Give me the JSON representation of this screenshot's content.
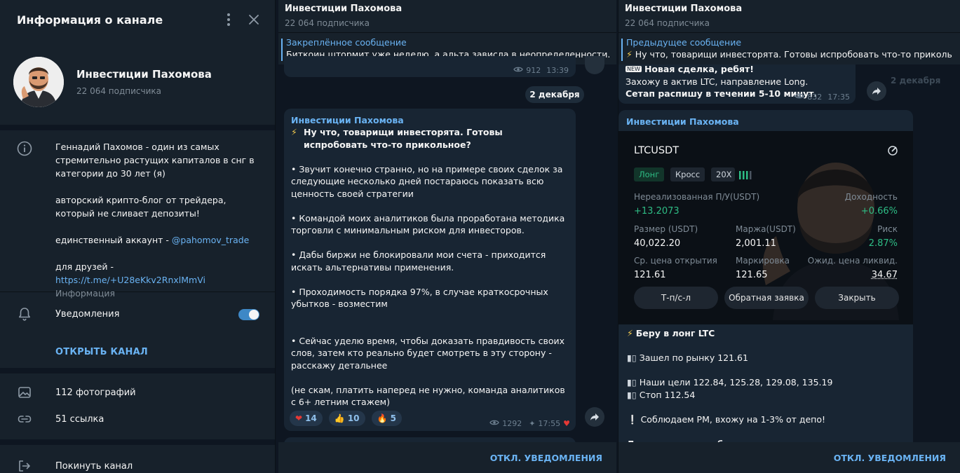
{
  "info": {
    "title": "Информация о канале",
    "channel_name": "Инвестиции Пахомова",
    "subscribers": "22 064 подписчика",
    "about_1": "Геннадий Пахомов - один из самых стремительно растущих капиталов в снг в категории до 30 лет (я)",
    "about_2": "авторский крипто-блог от трейдера, который не сливает депозиты!",
    "about_3_prefix": "единственный аккаунт - ",
    "about_3_link": "@pahomov_trade",
    "about_4_prefix": "для друзей - ",
    "about_4_link": "https://t.me/+U28eKkv2RnxlMmVi",
    "about_label": "Информация",
    "notifications_label": "Уведомления",
    "notifications_on": true,
    "open_channel": "ОТКРЫТЬ КАНАЛ",
    "photos": "112 фотографий",
    "links": "51 ссылка",
    "leave": "Покинуть канал"
  },
  "chat1": {
    "title": "Инвестиции Пахомова",
    "subtitle": "22 064 подписчика",
    "pinned_label": "Закреплённое сообщение",
    "pinned_text": "Биткоин штормит уже неделю, а альта зависла в неопределенности. Как не уй",
    "prev_views": "912",
    "prev_time": "13:39",
    "date_pill": "2 декабря",
    "msg": {
      "sender": "Инвестиции Пахомова",
      "title": "Ну что, товарищи инвесторята. Готовы испробовать что-то прикольное?",
      "p1": "• Звучит конечно странно, но на примере своих сделок за следующие несколько дней постараюсь показать всю ценность своей стратегии",
      "p2": "• Командой моих аналитиков была проработана методика торговли с минимальным риском для инвесторов.",
      "p3": "• Дабы биржи не блокировали мои счета - приходится искать альтернативы применения.",
      "p4": "• Проходимость порядка 97%, в случае краткосрочных убытков - возместим",
      "p5": "• Сейчас уделю время, чтобы доказать правдивость своих слов, затем кто реально будет смотреть в эту сторону - расскажу детальнее",
      "p6": "(не скам, платить наперед не нужно, команда аналитиков с 6+ летним стажем)",
      "reactions": [
        {
          "emoji": "❤️",
          "count": "14"
        },
        {
          "emoji": "👍",
          "count": "10"
        },
        {
          "emoji": "🔥",
          "count": "5"
        }
      ],
      "views": "1292",
      "time": "17:55"
    },
    "bottom": "ОТКЛ. УВЕДОМЛЕНИЯ"
  },
  "chat2": {
    "title": "Инвестиции Пахомова",
    "subtitle": "22 064 подписчика",
    "prev_label": "Предыдущее сообщение",
    "prev_text": "Ну что, товарищи инвесторята. Готовы испробовать что-то прикольное?",
    "top_msg_line1": "Новая сделка, ребят!",
    "top_msg_line2": "Захожу в актив LTC, направление Long.",
    "top_msg_line3": "Сетап распишу в течении 5-10 минут.",
    "top_views": "832",
    "top_time": "17:35",
    "date_ghost": "2 декабря",
    "sender": "Инвестиции Пахомова",
    "card": {
      "symbol": "LTCUSDT",
      "chip_long": "Лонг",
      "chip_cross": "Кросс",
      "chip_lev": "20X",
      "unreal_label": "Нереализованная П/У(USDT)",
      "unreal_value": "+13.2073",
      "yield_label": "Доходность",
      "yield_value": "+0.66%",
      "size_label": "Размер (USDT)",
      "size_value": "40,022.20",
      "margin_label": "Маржа(USDT)",
      "margin_value": "2,001.11",
      "risk_label": "Риск",
      "risk_value": "2.87%",
      "entry_label": "Ср. цена открытия",
      "entry_value": "121.61",
      "mark_label": "Маркировка",
      "mark_value": "121.65",
      "liq_label": "Ожид. цена ликвид.",
      "liq_value": "34.67",
      "btn1": "Т-п/с-л",
      "btn2": "Обратная заявка",
      "btn3": "Закрыть"
    },
    "line1": "Беру в лонг LTC",
    "line2": "Зашел по рынку 121.61",
    "line3": "Наши цели  122.84, 125.28, 129.08, 135.19",
    "line4": "Стоп 112.54",
    "line5": "Соблюдаем РМ, вхожу на 1-3% от депо!",
    "line6": "Дополнительные бонусы от меня лично за регистрацию на",
    "bottom": "ОТКЛ. УВЕДОМЛЕНИЯ"
  }
}
